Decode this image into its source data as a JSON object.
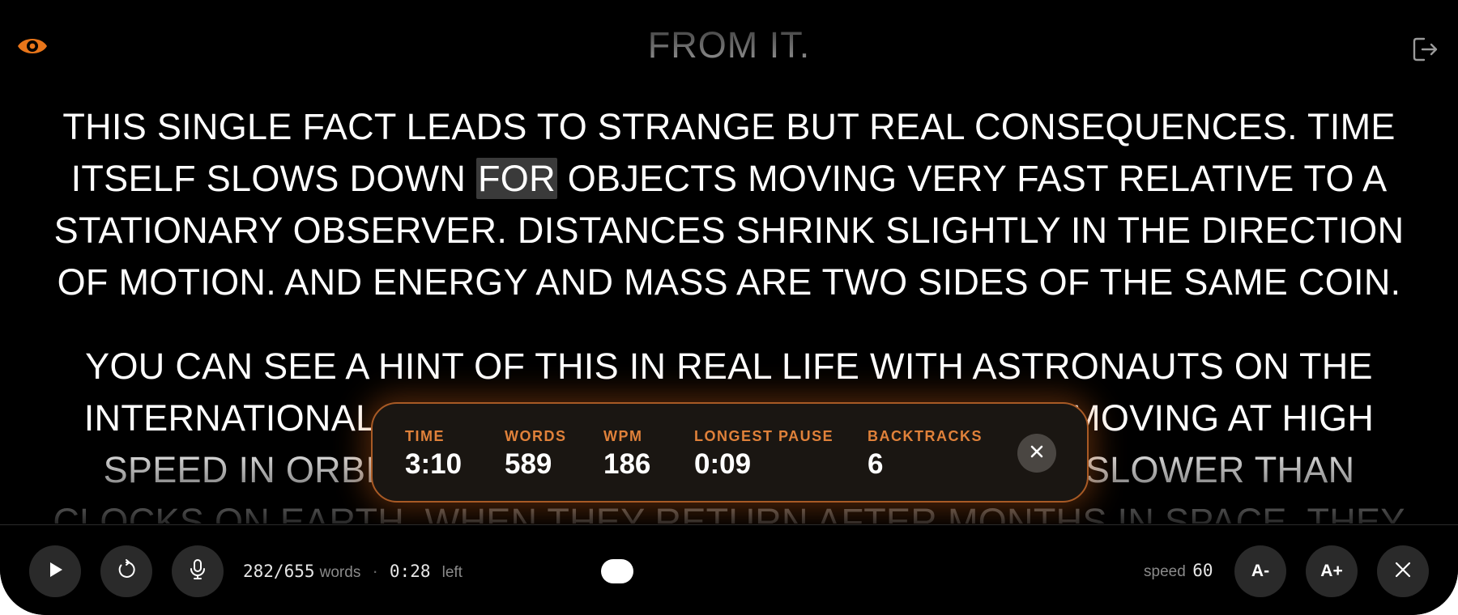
{
  "header": {
    "previous_line": "FROM IT."
  },
  "teleprompter": {
    "paragraphs": [
      {
        "before": "THIS SINGLE FACT LEADS TO STRANGE BUT REAL CONSEQUENCES. TIME ITSELF SLOWS DOWN ",
        "current": "FOR",
        "after": " OBJECTS MOVING VERY FAST RELATIVE TO A STATIONARY OBSERVER. DISTANCES SHRINK SLIGHTLY IN THE DIRECTION OF MOTION. AND ENERGY AND MASS ARE TWO SIDES OF THE SAME COIN."
      },
      {
        "text": "YOU CAN SEE A HINT OF THIS IN REAL LIFE WITH ASTRONAUTS ON THE INTERNATIONAL SPACE STATION. BECAUSE THEY ARE MOVING AT HIGH SPEED IN ORBIT, THEIR CLOCKS TICK VERY SLIGHTLY SLOWER THAN CLOCKS ON EARTH. WHEN THEY RETURN AFTER MONTHS IN SPACE, THEY"
      }
    ]
  },
  "stats": {
    "time_label": "TIME",
    "time_value": "3:10",
    "words_label": "WORDS",
    "words_value": "589",
    "wpm_label": "WPM",
    "wpm_value": "186",
    "pause_label": "LONGEST PAUSE",
    "pause_value": "0:09",
    "backtracks_label": "BACKTRACKS",
    "backtracks_value": "6"
  },
  "toolbar": {
    "progress_count": "282/655",
    "words_label": "words",
    "separator": "·",
    "time_left": "0:28",
    "left_label": "left",
    "speed_label": "speed",
    "speed_value": "60",
    "font_decrease_label": "A-",
    "font_increase_label": "A+"
  },
  "colors": {
    "accent": "#e0813a",
    "background": "#000000",
    "text": "#ffffff",
    "button_bg": "#2a2a2a"
  },
  "icons": {
    "top_left": "eye-icon",
    "top_right": "exit-icon",
    "play": "play-icon",
    "restart": "restart-icon",
    "mic": "microphone-icon",
    "close": "close-icon"
  }
}
